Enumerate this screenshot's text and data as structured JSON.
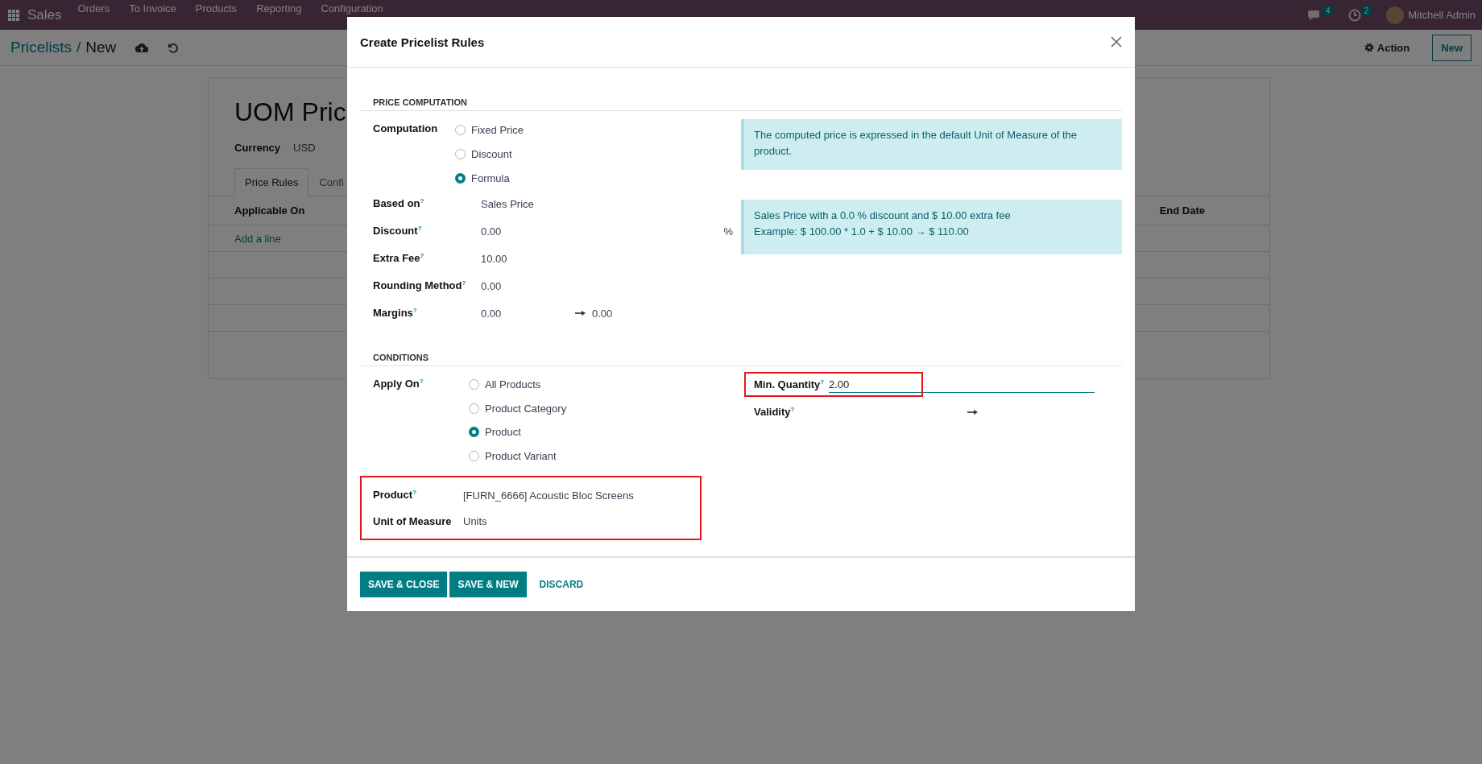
{
  "navbar": {
    "app_name": "Sales",
    "menu": [
      "Orders",
      "To Invoice",
      "Products",
      "Reporting",
      "Configuration"
    ],
    "messages_count": "4",
    "activities_count": "2",
    "user_name": "Mitchell Admin"
  },
  "control_panel": {
    "breadcrumb_parent": "Pricelists",
    "breadcrumb_separator": "/",
    "breadcrumb_current": "New",
    "action_label": "Action",
    "new_label": "New"
  },
  "form": {
    "title": "UOM Pric",
    "currency_label": "Currency",
    "currency_value": "USD",
    "tabs": [
      {
        "label": "Price Rules",
        "selected": true
      },
      {
        "label": "Confi",
        "selected": false
      }
    ],
    "columns": [
      "Applicable On",
      "End Date"
    ],
    "add_line": "Add a line"
  },
  "dialog": {
    "title": "Create Pricelist Rules",
    "price_computation": {
      "heading": "PRICE COMPUTATION",
      "computation_label": "Computation",
      "computation_options": [
        {
          "label": "Fixed Price",
          "selected": false
        },
        {
          "label": "Discount",
          "selected": false
        },
        {
          "label": "Formula",
          "selected": true
        }
      ],
      "fields": [
        {
          "label": "Based on$^{?}$",
          "value": "Sales Price"
        },
        {
          "label": "Discount$^{?}$",
          "value": "0.00",
          "suffix": "%"
        },
        {
          "label": "Extra Fee$^{?}$",
          "value": "10.00"
        },
        {
          "label": "Rounding Method$^{?}$",
          "value": "0.00"
        },
        {
          "label": "Margins$^{?}$",
          "value": "0.00",
          "max_value": "0.00"
        }
      ],
      "uom_note": "The computed price is expressed in the default Unit of Measure of the product.",
      "formula_lines": [
        "Sales Price with a 0.0 % discount and $ 10.00 extra fee",
        "Example: $ 100.00 * 1.0 + $ 10.00 → $ 110.00"
      ]
    },
    "conditions": {
      "heading": "CONDITIONS",
      "apply_on_label": "Apply On$^{?}$",
      "apply_on_options": [
        {
          "label": "All Products",
          "selected": false
        },
        {
          "label": "Product Category",
          "selected": false
        },
        {
          "label": "Product",
          "selected": true
        },
        {
          "label": "Product Variant",
          "selected": false
        }
      ],
      "product_fields": {
        "highlighted": true,
        "fields": [
          {
            "label": "Product$^{?}$",
            "value": "[FURN_6666] Acoustic Bloc Screens"
          },
          {
            "label": "Unit of Measure",
            "value": "Units"
          }
        ]
      },
      "min_quantity": {
        "label": "Min. Quantity$^{?}$",
        "value": "2.00",
        "highlighted": true
      },
      "validity": {
        "label": "Validity$^{?}$"
      }
    },
    "buttons": [
      {
        "label": "SAVE & CLOSE",
        "kind": "primary"
      },
      {
        "label": "SAVE & NEW",
        "kind": "primary"
      },
      {
        "label": "DISCARD",
        "kind": "link"
      }
    ]
  }
}
